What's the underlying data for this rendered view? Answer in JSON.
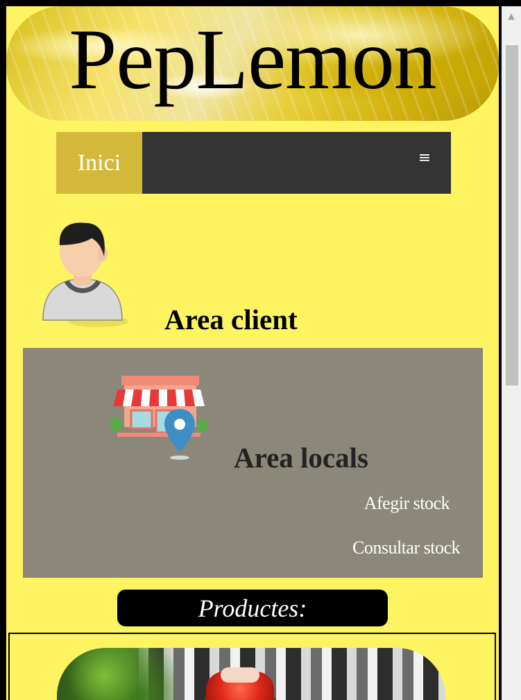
{
  "header": {
    "site_title": "PepLemon"
  },
  "nav": {
    "home_label": "Inici",
    "menu_icon": "≡"
  },
  "client": {
    "title": "Area client"
  },
  "locals": {
    "title": "Area locals",
    "links": [
      "Afegir stock",
      "Consultar stock"
    ]
  },
  "products": {
    "label": "Productes:"
  },
  "scrollbar": {
    "up_arrow": "▲"
  },
  "colors": {
    "page_bg": "#fef462",
    "nav_bg": "#333333",
    "nav_active": "#d4b83a",
    "locals_bg": "#8b877a"
  }
}
